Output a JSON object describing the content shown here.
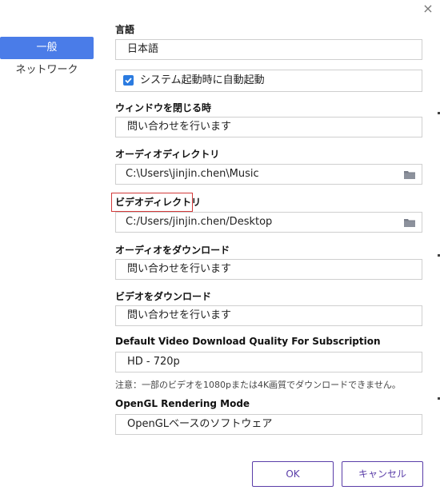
{
  "sidebar": {
    "items": [
      {
        "label": "一般"
      },
      {
        "label": "ネットワーク"
      }
    ]
  },
  "close_icon": "×",
  "language": {
    "label": "言語",
    "value": "日本語"
  },
  "auto_start": {
    "label": "システム起動時に自動起動",
    "checked": true
  },
  "close_window": {
    "label": "ウィンドウを閉じる時",
    "value": "問い合わせを行います"
  },
  "audio_dir": {
    "label": "オーディオディレクトリ",
    "value": "C:\\Users\\jinjin.chen\\Music",
    "icon": "folder-icon"
  },
  "video_dir": {
    "label": "ビデオディレクトリ",
    "value": "C:/Users/jinjin.chen/Desktop",
    "icon": "folder-icon"
  },
  "audio_download": {
    "label": "オーディオをダウンロード",
    "value": "問い合わせを行います"
  },
  "video_download": {
    "label": "ビデオをダウンロード",
    "value": "問い合わせを行います"
  },
  "default_quality": {
    "label": "Default Video Download Quality For Subscription",
    "value": "HD - 720p",
    "note": "注意：一部のビデオを1080pまたは4K画質でダウンロードできません。"
  },
  "opengl": {
    "label": "OpenGL Rendering Mode",
    "value": "OpenGLベースのソフトウェア"
  },
  "buttons": {
    "ok": "OK",
    "cancel": "キャンセル"
  },
  "colors": {
    "accent": "#4a7ce8",
    "button_border": "#5a3da8",
    "highlight": "#d23a3a"
  }
}
